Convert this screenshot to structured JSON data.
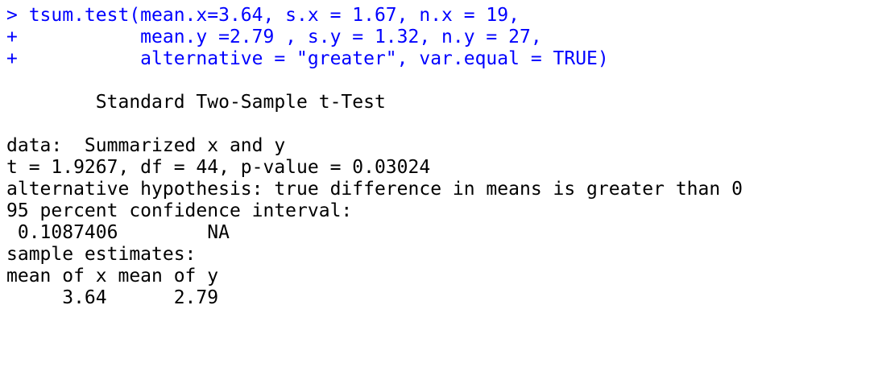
{
  "console": {
    "command_lines": [
      "> tsum.test(mean.x=3.64, s.x = 1.67, n.x = 19,",
      "+           mean.y =2.79 , s.y = 1.32, n.y = 27,",
      "+           alternative = \"greater\", var.equal = TRUE)"
    ],
    "test_title": "        Standard Two-Sample t-Test",
    "data_line": "data:  Summarized x and y",
    "statistic_line": "t = 1.9267, df = 44, p-value = 0.03024",
    "alternative_line": "alternative hypothesis: true difference in means is greater than 0",
    "ci_header": "95 percent confidence interval:",
    "ci_values": " 0.1087406        NA",
    "estimates_header": "sample estimates:",
    "estimates_labels": "mean of x mean of y",
    "estimates_values": "     3.64      2.79"
  },
  "colors": {
    "command": "#0000ff",
    "output": "#000000",
    "background": "#ffffff"
  }
}
